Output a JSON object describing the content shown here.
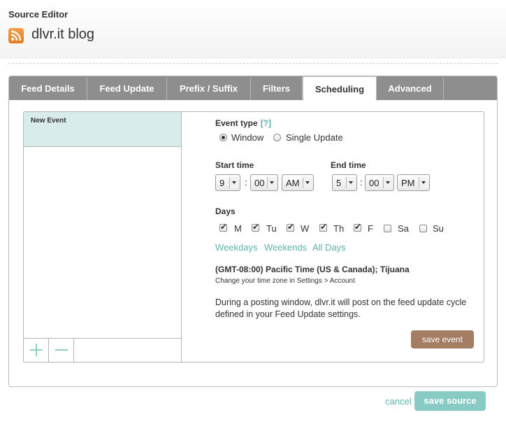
{
  "header": {
    "title": "Source Editor",
    "feed_name": "dlvr.it blog",
    "feed_icon": "rss-icon"
  },
  "tabs": [
    {
      "label": "Feed Details",
      "active": false
    },
    {
      "label": "Feed Update",
      "active": false
    },
    {
      "label": "Prefix / Suffix",
      "active": false
    },
    {
      "label": "Filters",
      "active": false
    },
    {
      "label": "Scheduling",
      "active": true
    },
    {
      "label": "Advanced",
      "active": false
    }
  ],
  "event_list": {
    "items": [
      "New Event"
    ],
    "add_icon": "plus-icon",
    "remove_icon": "minus-icon"
  },
  "event_form": {
    "event_type_label": "Event type",
    "help_link": "[?]",
    "types": [
      {
        "label": "Window",
        "selected": true
      },
      {
        "label": "Single Update",
        "selected": false
      }
    ],
    "start_time": {
      "label": "Start time",
      "hour": "9",
      "minute": "00",
      "ampm": "AM"
    },
    "end_time": {
      "label": "End time",
      "hour": "5",
      "minute": "00",
      "ampm": "PM"
    },
    "time_separator": ":",
    "days_label": "Days",
    "days": [
      {
        "label": "M",
        "checked": true
      },
      {
        "label": "Tu",
        "checked": true
      },
      {
        "label": "W",
        "checked": true
      },
      {
        "label": "Th",
        "checked": true
      },
      {
        "label": "F",
        "checked": true
      },
      {
        "label": "Sa",
        "checked": false
      },
      {
        "label": "Su",
        "checked": false
      }
    ],
    "day_presets": [
      "Weekdays",
      "Weekends",
      "All Days"
    ],
    "timezone": "(GMT-08:00) Pacific Time (US & Canada); Tijuana",
    "timezone_hint": "Change your time zone in Settings > Account",
    "description": "During a posting window, dlvr.it will post on the feed update cycle defined in your Feed Update settings.",
    "save_label": "save event"
  },
  "footer": {
    "cancel_label": "cancel",
    "save_label": "save source"
  },
  "colors": {
    "accent_teal": "#5fb3ad",
    "save_source_bg": "#88cbc4",
    "save_event_bg": "#a57d63",
    "tab_bg": "#8e8e8e",
    "selected_event_bg": "#d8eceb"
  }
}
